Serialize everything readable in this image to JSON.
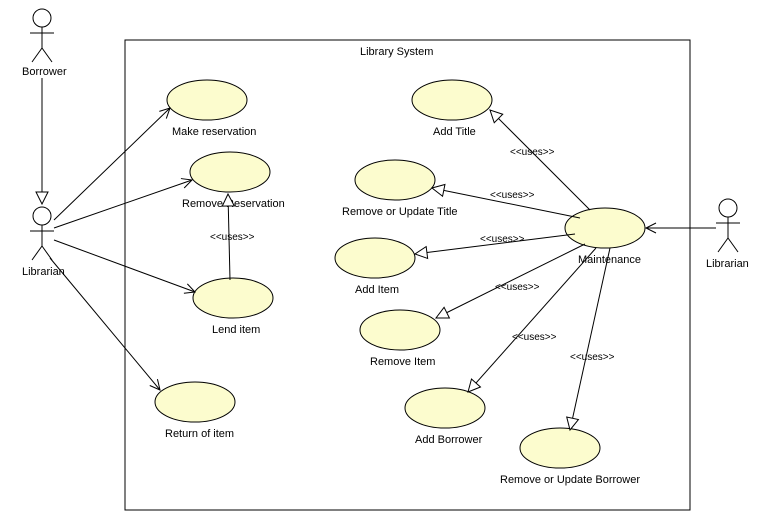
{
  "system": {
    "title": "Library System"
  },
  "actors": {
    "borrower": "Borrower",
    "librarian_left": "Librarian",
    "librarian_right": "Librarian"
  },
  "usecases": {
    "make_reservation": "Make reservation",
    "remove_reservation": "Remove Reservation",
    "lend_item": "Lend item",
    "return_item": "Return of item",
    "add_title": "Add Title",
    "remove_update_title": "Remove or Update Title",
    "add_item": "Add Item",
    "remove_item": "Remove Item",
    "add_borrower": "Add Borrower",
    "remove_update_borrower": "Remove or Update Borrower",
    "maintenance": "Maintenance"
  },
  "stereotypes": {
    "uses": "<<uses>>"
  }
}
